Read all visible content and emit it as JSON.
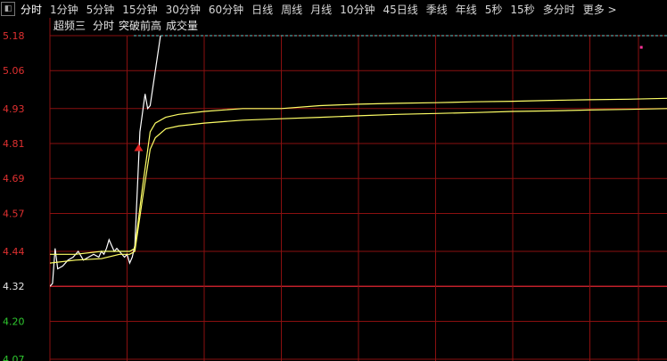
{
  "toolbar": {
    "collapse_icon": "panel-toggle-icon",
    "tabs": [
      {
        "label": "分时"
      },
      {
        "label": "1分钟"
      },
      {
        "label": "5分钟"
      },
      {
        "label": "15分钟"
      },
      {
        "label": "30分钟"
      },
      {
        "label": "60分钟"
      },
      {
        "label": "日线"
      },
      {
        "label": "周线"
      },
      {
        "label": "月线"
      },
      {
        "label": "10分钟"
      },
      {
        "label": "45日线"
      },
      {
        "label": "季线"
      },
      {
        "label": "年线"
      },
      {
        "label": "5秒"
      },
      {
        "label": "15秒"
      },
      {
        "label": "多分时"
      },
      {
        "label": "更多 >"
      }
    ]
  },
  "chart_data": {
    "type": "line",
    "legend": [
      "超频三",
      "分时",
      "突破前高",
      "成交量"
    ],
    "y_ticks": [
      {
        "label": "5.18",
        "value": 5.18,
        "color": "#e03030"
      },
      {
        "label": "5.06",
        "value": 5.06,
        "color": "#e03030"
      },
      {
        "label": "4.93",
        "value": 4.93,
        "color": "#e03030"
      },
      {
        "label": "4.81",
        "value": 4.81,
        "color": "#e03030"
      },
      {
        "label": "4.69",
        "value": 4.69,
        "color": "#e03030"
      },
      {
        "label": "4.57",
        "value": 4.57,
        "color": "#e03030"
      },
      {
        "label": "4.44",
        "value": 4.44,
        "color": "#e03030"
      },
      {
        "label": "4.32",
        "value": 4.32,
        "color": "#e6e6e6"
      },
      {
        "label": "4.20",
        "value": 4.2,
        "color": "#2fc82f"
      },
      {
        "label": "4.07",
        "value": 4.07,
        "color": "#2fc82f"
      }
    ],
    "ylim": [
      4.07,
      5.18
    ],
    "prev_close": 4.32,
    "x_range": [
      0,
      240
    ],
    "vertical_grid_minutes": [
      30,
      60,
      90,
      120,
      150,
      180,
      210
    ],
    "series": [
      {
        "color": "#ffffff",
        "points": [
          [
            0,
            4.32
          ],
          [
            1,
            4.33
          ],
          [
            2,
            4.45
          ],
          [
            3,
            4.38
          ],
          [
            5,
            4.39
          ],
          [
            7,
            4.41
          ],
          [
            9,
            4.42
          ],
          [
            11,
            4.44
          ],
          [
            13,
            4.41
          ],
          [
            15,
            4.42
          ],
          [
            17,
            4.43
          ],
          [
            19,
            4.42
          ],
          [
            20,
            4.44
          ],
          [
            21,
            4.43
          ],
          [
            22,
            4.45
          ],
          [
            23,
            4.48
          ],
          [
            24,
            4.46
          ],
          [
            25,
            4.44
          ],
          [
            26,
            4.45
          ],
          [
            27,
            4.44
          ],
          [
            29,
            4.42
          ],
          [
            30,
            4.43
          ],
          [
            31,
            4.4
          ],
          [
            32,
            4.42
          ],
          [
            33,
            4.46
          ],
          [
            35,
            4.85
          ],
          [
            37,
            4.98
          ],
          [
            38,
            4.93
          ],
          [
            39,
            4.94
          ],
          [
            40,
            5.0
          ],
          [
            43,
            5.18
          ],
          [
            44,
            5.5
          ]
        ]
      },
      {
        "color": "#ffff66",
        "points": [
          [
            0,
            4.43
          ],
          [
            10,
            4.43
          ],
          [
            20,
            4.44
          ],
          [
            27,
            4.44
          ],
          [
            31,
            4.44
          ],
          [
            33,
            4.45
          ],
          [
            36,
            4.66
          ],
          [
            39,
            4.85
          ],
          [
            41,
            4.88
          ],
          [
            45,
            4.9
          ],
          [
            50,
            4.91
          ],
          [
            60,
            4.92
          ],
          [
            75,
            4.93
          ],
          [
            90,
            4.93
          ],
          [
            105,
            4.94
          ],
          [
            120,
            4.945
          ],
          [
            135,
            4.948
          ],
          [
            150,
            4.95
          ],
          [
            165,
            4.953
          ],
          [
            180,
            4.955
          ],
          [
            195,
            4.958
          ],
          [
            210,
            4.96
          ],
          [
            225,
            4.962
          ],
          [
            240,
            4.965
          ]
        ]
      },
      {
        "color": "#ffff66",
        "points": [
          [
            0,
            4.4
          ],
          [
            10,
            4.41
          ],
          [
            20,
            4.415
          ],
          [
            27,
            4.43
          ],
          [
            31,
            4.43
          ],
          [
            33,
            4.44
          ],
          [
            36,
            4.62
          ],
          [
            39,
            4.79
          ],
          [
            41,
            4.83
          ],
          [
            45,
            4.86
          ],
          [
            50,
            4.87
          ],
          [
            60,
            4.88
          ],
          [
            75,
            4.89
          ],
          [
            90,
            4.895
          ],
          [
            105,
            4.9
          ],
          [
            120,
            4.905
          ],
          [
            135,
            4.91
          ],
          [
            150,
            4.913
          ],
          [
            165,
            4.916
          ],
          [
            180,
            4.92
          ],
          [
            195,
            4.922
          ],
          [
            210,
            4.925
          ],
          [
            225,
            4.927
          ],
          [
            240,
            4.93
          ]
        ]
      }
    ],
    "markers": [
      {
        "type": "up-arrow",
        "x": 34.5,
        "y": 4.79,
        "color": "#e02020"
      },
      {
        "type": "dot",
        "x": 230,
        "y": 5.14,
        "color": "#ff3399"
      }
    ],
    "reference_line": {
      "y": 5.18,
      "color": "#66cccc",
      "style": "dashed"
    }
  }
}
